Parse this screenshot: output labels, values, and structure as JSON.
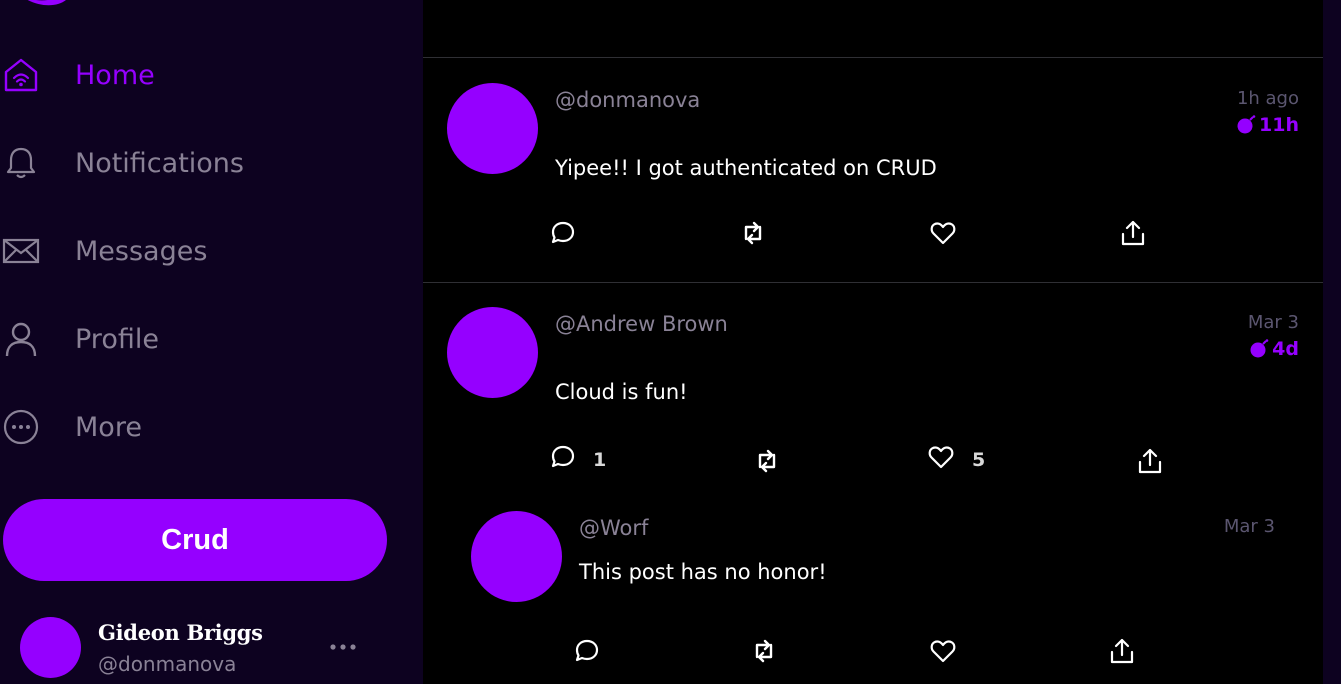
{
  "colors": {
    "accent": "#9500ff",
    "sidebar_bg": "#0d0220",
    "feed_bg": "#000000",
    "muted": "#8a8296"
  },
  "sidebar": {
    "items": [
      {
        "label": "Home",
        "icon": "home-icon",
        "active": true
      },
      {
        "label": "Notifications",
        "icon": "bell-icon"
      },
      {
        "label": "Messages",
        "icon": "envelope-icon"
      },
      {
        "label": "Profile",
        "icon": "user-icon"
      },
      {
        "label": "More",
        "icon": "more-circle-icon"
      }
    ],
    "crud_label": "Crud",
    "profile": {
      "name": "Gideon Briggs",
      "handle": "@donmanova"
    }
  },
  "posts": [
    {
      "handle": "@donmanova",
      "date": "1h ago",
      "expires": "11h",
      "message": "Yipee!! I got authenticated on CRUD",
      "reply_count": "",
      "like_count": ""
    },
    {
      "handle": "@Andrew Brown",
      "date": "Mar 3",
      "expires": "4d",
      "message": "Cloud is fun!",
      "reply_count": "1",
      "like_count": "5",
      "replies": [
        {
          "handle": "@Worf",
          "date": "Mar 3",
          "message": "This post has no honor!"
        }
      ]
    }
  ]
}
